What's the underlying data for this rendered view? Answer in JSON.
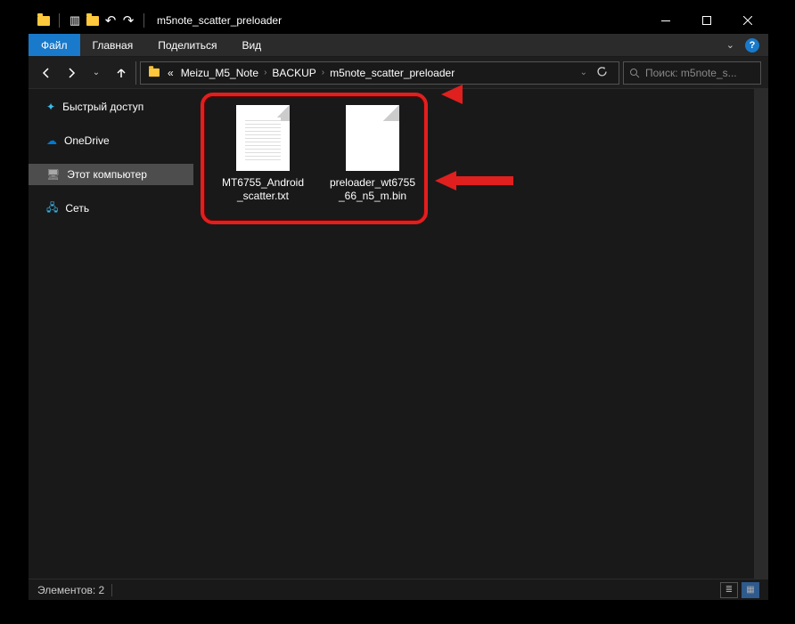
{
  "titlebar": {
    "title": "m5note_scatter_preloader"
  },
  "ribbon": {
    "file": "Файл",
    "home": "Главная",
    "share": "Поделиться",
    "view": "Вид"
  },
  "breadcrumb": {
    "prefix": "«",
    "seg1": "Meizu_M5_Note",
    "seg2": "BACKUP",
    "seg3": "m5note_scatter_preloader"
  },
  "search": {
    "placeholder": "Поиск: m5note_s..."
  },
  "sidebar": {
    "quick_access": "Быстрый доступ",
    "onedrive": "OneDrive",
    "this_pc": "Этот компьютер",
    "network": "Сеть"
  },
  "files": {
    "f1_line1": "MT6755_Android",
    "f1_line2": "_scatter.txt",
    "f2_line1": "preloader_wt6755",
    "f2_line2": "_66_n5_m.bin"
  },
  "statusbar": {
    "count_label": "Элементов: 2"
  }
}
